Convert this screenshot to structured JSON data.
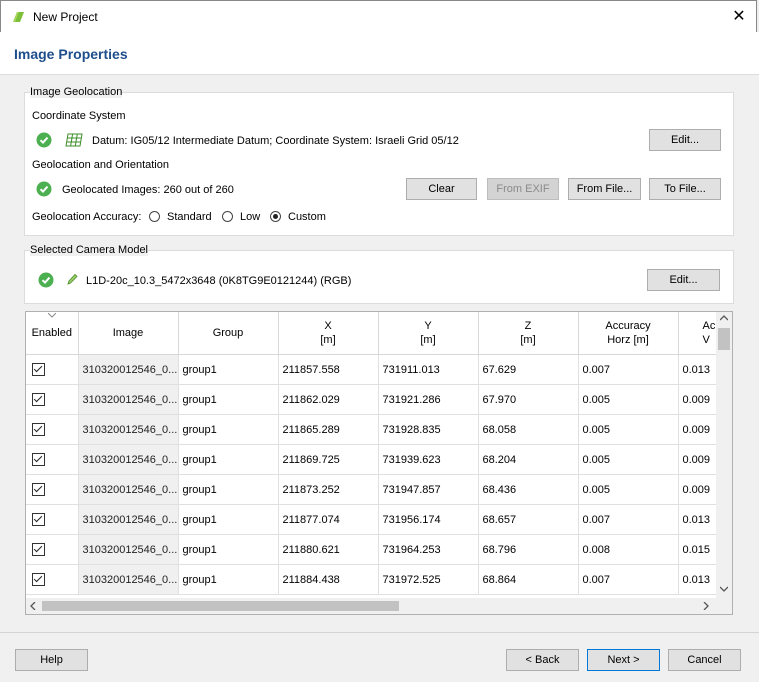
{
  "window": {
    "title": "New Project",
    "close_glyph": "✕"
  },
  "page_title": "Image Properties",
  "geolocation": {
    "group_label": "Image Geolocation",
    "coord_system_label": "Coordinate System",
    "datum_text": "Datum: IG05/12 Intermediate Datum; Coordinate System: Israeli Grid 05/12",
    "edit_label": "Edit...",
    "geo_orient_label": "Geolocation and Orientation",
    "geolocated_text": "Geolocated Images: 260 out of 260",
    "clear_label": "Clear",
    "from_exif_label": "From EXIF",
    "from_file_label": "From File...",
    "to_file_label": "To File...",
    "accuracy_label": "Geolocation Accuracy:",
    "accuracy_options": [
      "Standard",
      "Low",
      "Custom"
    ],
    "accuracy_selected": "Custom"
  },
  "camera": {
    "group_label": "Selected Camera Model",
    "model_text": "L1D-20c_10.3_5472x3648 (0K8TG9E0121244) (RGB)",
    "edit_label": "Edit..."
  },
  "table": {
    "headers": {
      "enabled": "Enabled",
      "image": "Image",
      "group": "Group",
      "x_line1": "X",
      "x_line2": "[m]",
      "y_line1": "Y",
      "y_line2": "[m]",
      "z_line1": "Z",
      "z_line2": "[m]",
      "acc_line1": "Accuracy",
      "acc_line2": "Horz [m]",
      "accv_line1": "Ac",
      "accv_line2": "V"
    },
    "rows": [
      {
        "enabled": true,
        "image": "310320012546_0...",
        "group": "group1",
        "x": "211857.558",
        "y": "731911.013",
        "z": "67.629",
        "acc_h": "0.007",
        "acc_v": "0.013"
      },
      {
        "enabled": true,
        "image": "310320012546_0...",
        "group": "group1",
        "x": "211862.029",
        "y": "731921.286",
        "z": "67.970",
        "acc_h": "0.005",
        "acc_v": "0.009"
      },
      {
        "enabled": true,
        "image": "310320012546_0...",
        "group": "group1",
        "x": "211865.289",
        "y": "731928.835",
        "z": "68.058",
        "acc_h": "0.005",
        "acc_v": "0.009"
      },
      {
        "enabled": true,
        "image": "310320012546_0...",
        "group": "group1",
        "x": "211869.725",
        "y": "731939.623",
        "z": "68.204",
        "acc_h": "0.005",
        "acc_v": "0.009"
      },
      {
        "enabled": true,
        "image": "310320012546_0...",
        "group": "group1",
        "x": "211873.252",
        "y": "731947.857",
        "z": "68.436",
        "acc_h": "0.005",
        "acc_v": "0.009"
      },
      {
        "enabled": true,
        "image": "310320012546_0...",
        "group": "group1",
        "x": "211877.074",
        "y": "731956.174",
        "z": "68.657",
        "acc_h": "0.007",
        "acc_v": "0.013"
      },
      {
        "enabled": true,
        "image": "310320012546_0...",
        "group": "group1",
        "x": "211880.621",
        "y": "731964.253",
        "z": "68.796",
        "acc_h": "0.008",
        "acc_v": "0.015"
      },
      {
        "enabled": true,
        "image": "310320012546_0...",
        "group": "group1",
        "x": "211884.438",
        "y": "731972.525",
        "z": "68.864",
        "acc_h": "0.007",
        "acc_v": "0.013"
      }
    ]
  },
  "footer": {
    "help_label": "Help",
    "back_label": "< Back",
    "next_label": "Next >",
    "cancel_label": "Cancel"
  },
  "colors": {
    "title_blue": "#1f4e8c",
    "ok_green": "#4caf50",
    "accent": "#0078d7"
  }
}
